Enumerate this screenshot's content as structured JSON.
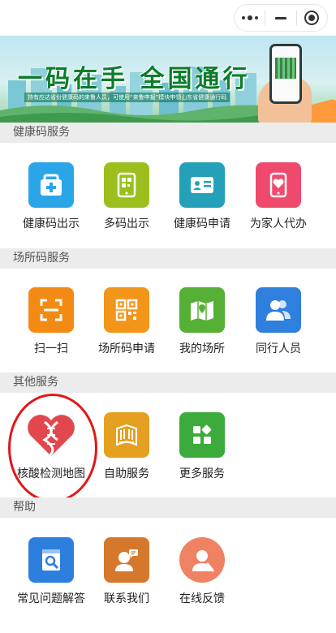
{
  "banner": {
    "title": "一码在手  全国通行",
    "subtitle": "持有应达省份健康码的来鲁人员，可使用“来鲁申报”模块申领山东省健康通行码"
  },
  "colors": {
    "blue": "#2aa6e8",
    "lime": "#9cbf1e",
    "teal": "#24a0b8",
    "pink": "#ef4a6e",
    "orange": "#f38a14",
    "orange2": "#f39519",
    "green": "#56b036",
    "blue2": "#2f7fde",
    "red": "#e2474d",
    "gold": "#e5a022",
    "green2": "#3cab3b",
    "helpblue": "#2d7fde",
    "brown": "#d6782c",
    "salmon": "#f08264"
  },
  "sections": [
    {
      "title": "健康码服务",
      "items": [
        {
          "label": "健康码出示",
          "icon": "medical-kit-icon"
        },
        {
          "label": "多码出示",
          "icon": "phone-qr-icon"
        },
        {
          "label": "健康码申请",
          "icon": "id-card-icon"
        },
        {
          "label": "为家人代办",
          "icon": "phone-heart-icon"
        }
      ]
    },
    {
      "title": "场所码服务",
      "items": [
        {
          "label": "扫一扫",
          "icon": "scan-icon"
        },
        {
          "label": "场所码申请",
          "icon": "qr-code-icon"
        },
        {
          "label": "我的场所",
          "icon": "map-icon"
        },
        {
          "label": "同行人员",
          "icon": "people-icon"
        }
      ]
    },
    {
      "title": "其他服务",
      "items": [
        {
          "label": "核酸检测地图",
          "icon": "dna-heart-icon"
        },
        {
          "label": "自助服务",
          "icon": "building-icon"
        },
        {
          "label": "更多服务",
          "icon": "grid-icon"
        }
      ]
    },
    {
      "title": "帮助",
      "items": [
        {
          "label": "常见问题解答",
          "icon": "faq-search-icon"
        },
        {
          "label": "联系我们",
          "icon": "support-agent-icon"
        },
        {
          "label": "在线反馈",
          "icon": "feedback-person-icon"
        }
      ]
    }
  ]
}
